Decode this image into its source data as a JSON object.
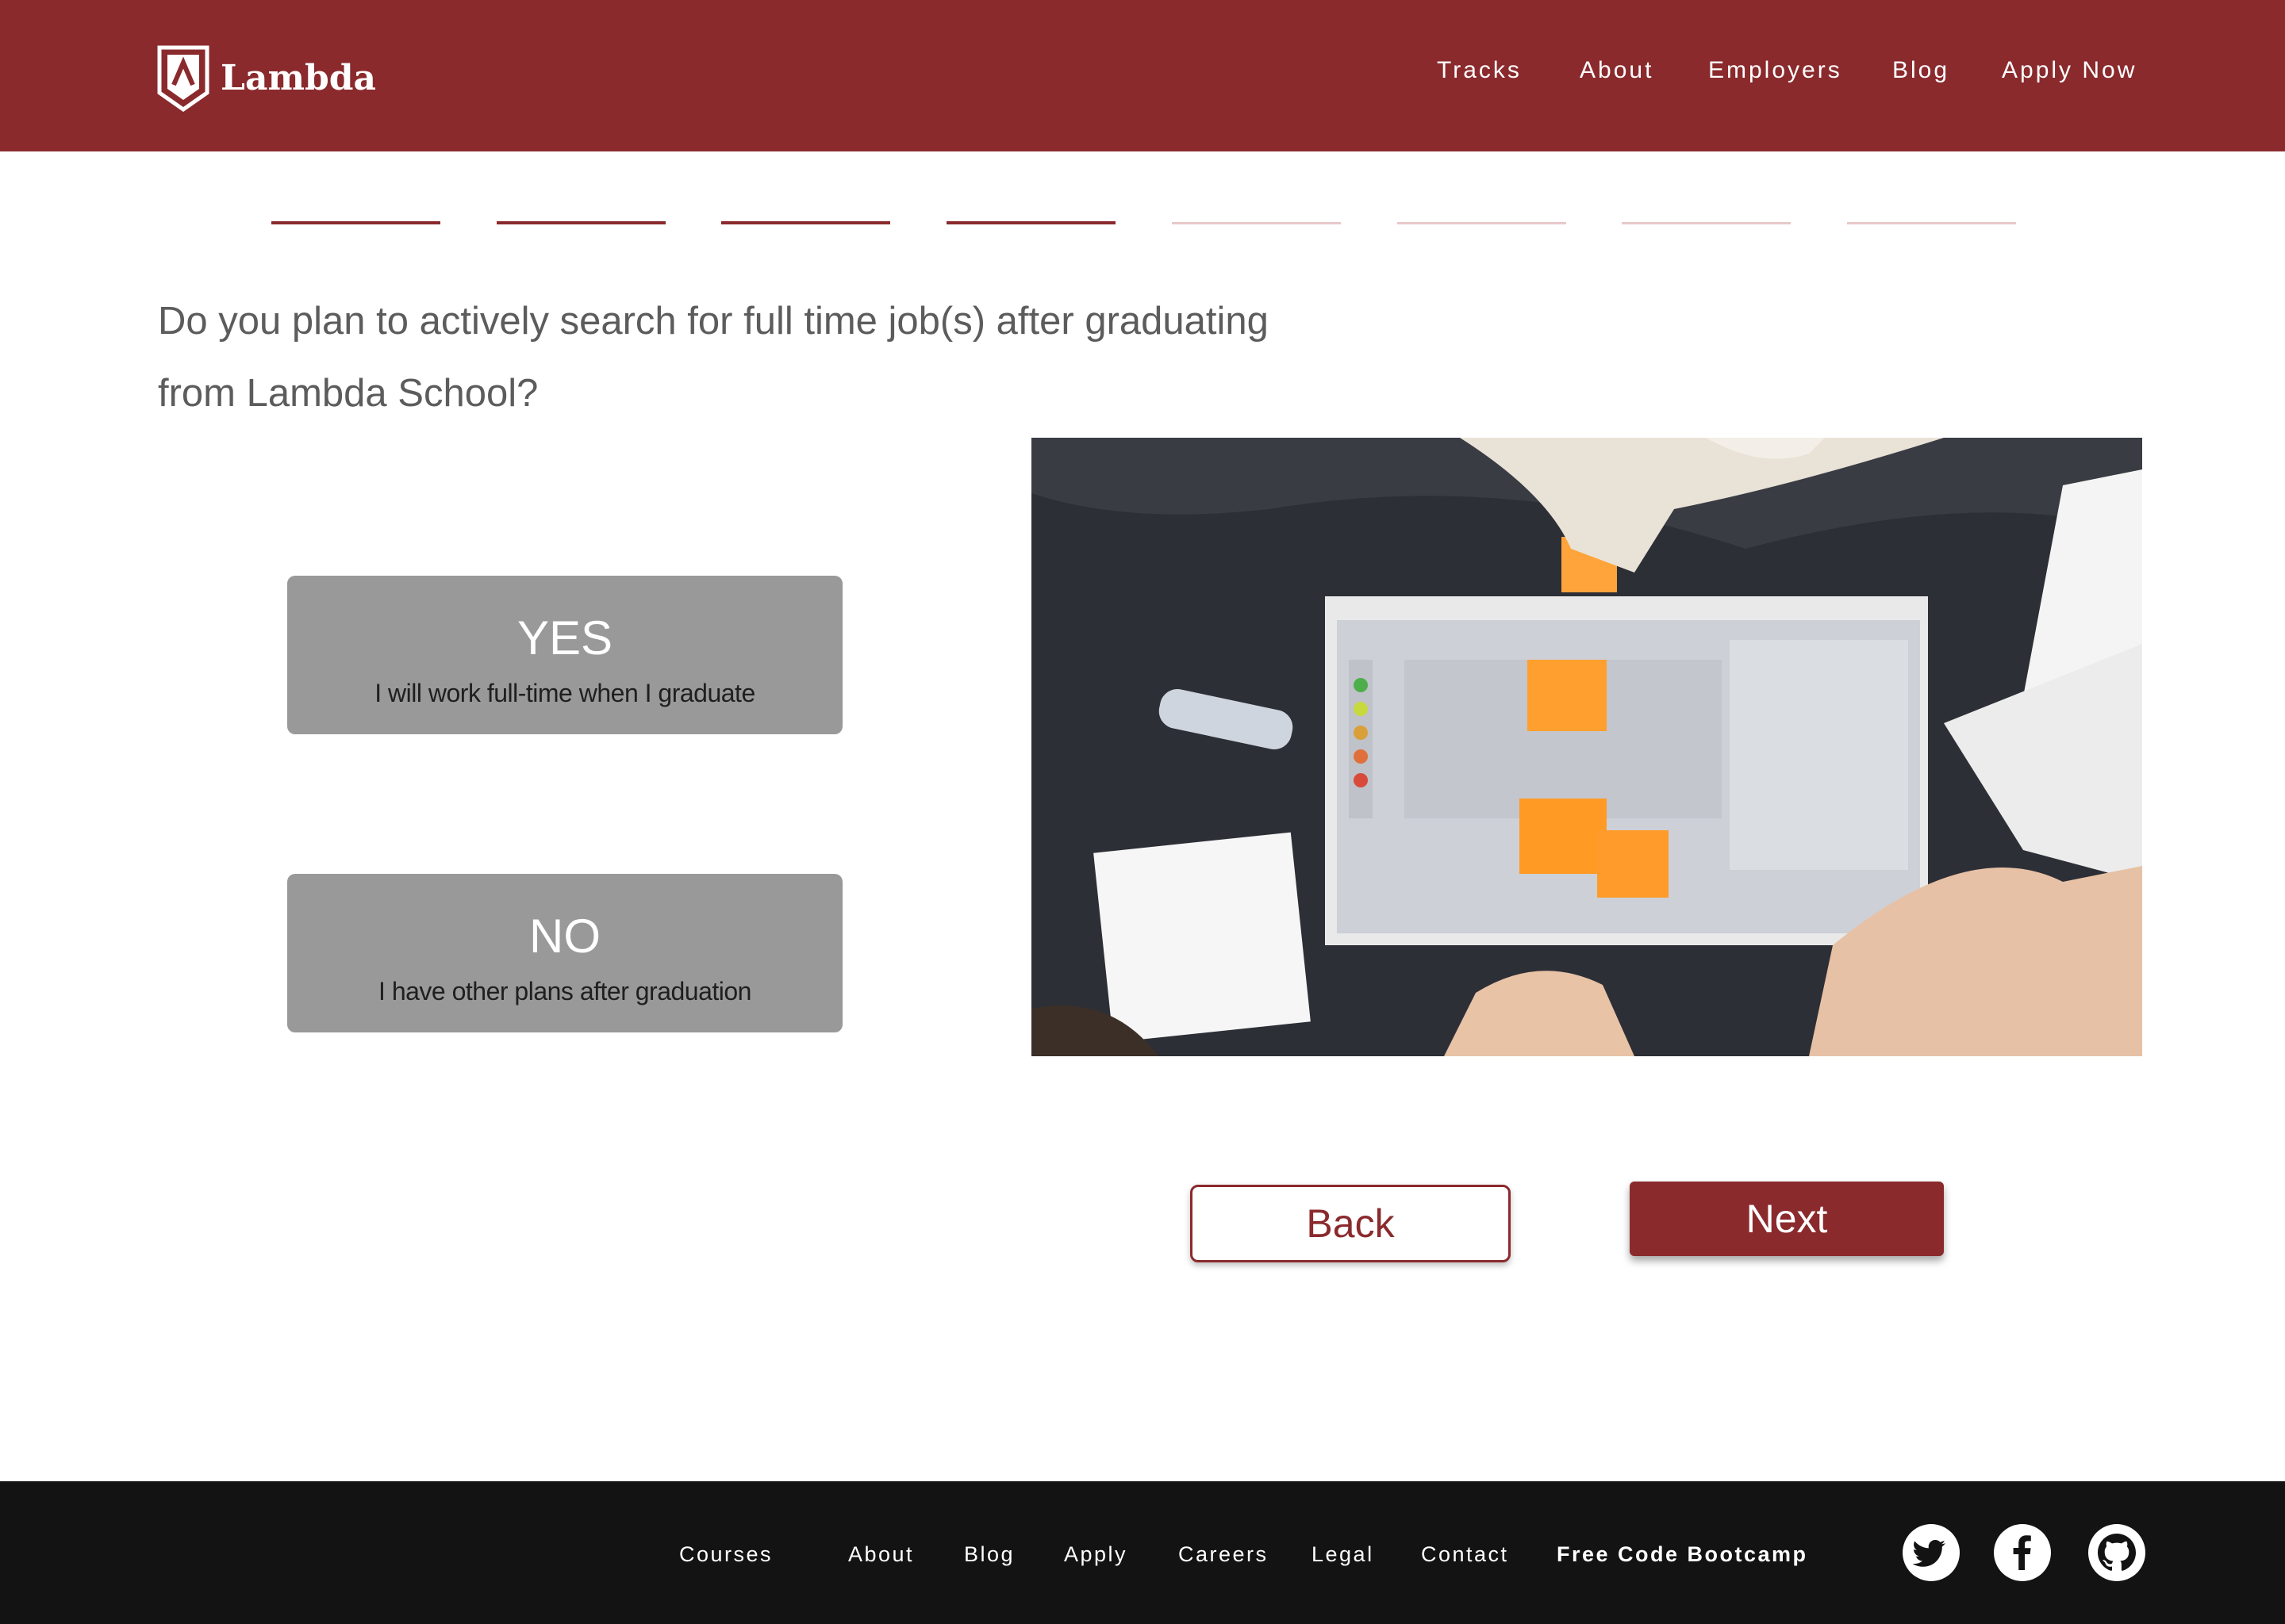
{
  "header": {
    "logo_text": "Lambda",
    "nav": [
      "Tracks",
      "About",
      "Employers",
      "Blog",
      "Apply Now"
    ]
  },
  "progress": {
    "total_steps": 8,
    "completed_steps": 4
  },
  "question": "Do you plan to actively search for full time job(s) after graduating from Lambda School?",
  "options": [
    {
      "title": "YES",
      "subtitle": "I will work full-time when I graduate"
    },
    {
      "title": "NO",
      "subtitle": "I have other plans after graduation"
    }
  ],
  "buttons": {
    "back": "Back",
    "next": "Next"
  },
  "footer": {
    "links": [
      "Courses",
      "About",
      "Blog",
      "Apply",
      "Careers",
      "Legal",
      "Contact",
      "Free Code Bootcamp"
    ],
    "social": [
      "twitter-icon",
      "facebook-icon",
      "github-icon"
    ]
  },
  "colors": {
    "brand": "#8a2a2d",
    "option_bg": "#999999",
    "footer_bg": "#131313"
  }
}
